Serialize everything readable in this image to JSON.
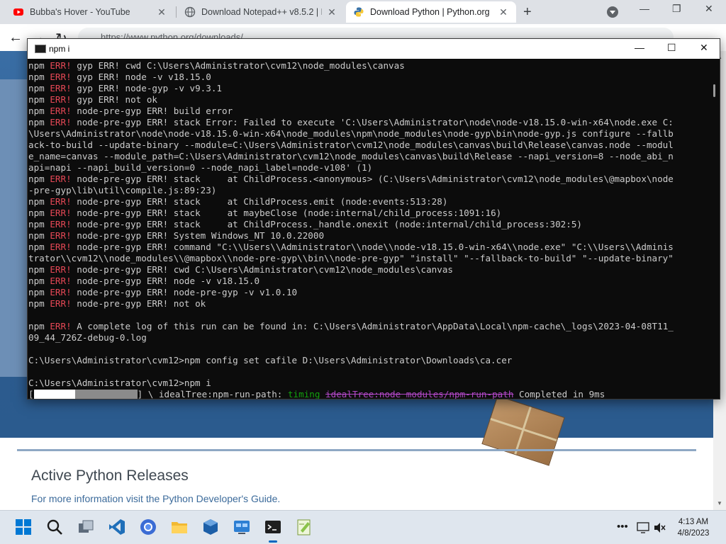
{
  "browser": {
    "tabs": [
      {
        "title": "Bubba's Hover - YouTube",
        "favicon": "youtube-icon"
      },
      {
        "title": "Download Notepad++ v8.5.2 | N",
        "favicon": "globe-icon"
      },
      {
        "title": "Download Python | Python.org",
        "favicon": "python-icon"
      }
    ],
    "new_tab": "+",
    "url": "https://www.python.org/downloads/",
    "back": "←",
    "forward": "→",
    "reload": "↻"
  },
  "page": {
    "releases_title": "Active Python Releases",
    "releases_link": "For more information visit the Python Developer's Guide."
  },
  "terminal": {
    "title": "npm i",
    "minimize": "—",
    "maximize": "☐",
    "close": "✕",
    "lines": [
      [
        {
          "t": "npm "
        },
        {
          "t": "ERR!",
          "c": "err"
        },
        {
          "t": " gyp ERR! cwd C:\\Users\\Administrator\\cvm12\\node_modules\\canvas"
        }
      ],
      [
        {
          "t": "npm "
        },
        {
          "t": "ERR!",
          "c": "err"
        },
        {
          "t": " gyp ERR! node -v v18.15.0"
        }
      ],
      [
        {
          "t": "npm "
        },
        {
          "t": "ERR!",
          "c": "err"
        },
        {
          "t": " gyp ERR! node-gyp -v v9.3.1"
        }
      ],
      [
        {
          "t": "npm "
        },
        {
          "t": "ERR!",
          "c": "err"
        },
        {
          "t": " gyp ERR! not ok"
        }
      ],
      [
        {
          "t": "npm "
        },
        {
          "t": "ERR!",
          "c": "err"
        },
        {
          "t": " node-pre-gyp ERR! build error"
        }
      ],
      [
        {
          "t": "npm "
        },
        {
          "t": "ERR!",
          "c": "err"
        },
        {
          "t": " node-pre-gyp ERR! stack Error: Failed to execute 'C:\\Users\\Administrator\\node\\node-v18.15.0-win-x64\\node.exe C:"
        }
      ],
      [
        {
          "t": "\\Users\\Administrator\\node\\node-v18.15.0-win-x64\\node_modules\\npm\\node_modules\\node-gyp\\bin\\node-gyp.js configure --fallb"
        }
      ],
      [
        {
          "t": "ack-to-build --update-binary --module=C:\\Users\\Administrator\\cvm12\\node_modules\\canvas\\build\\Release\\canvas.node --modul"
        }
      ],
      [
        {
          "t": "e_name=canvas --module_path=C:\\Users\\Administrator\\cvm12\\node_modules\\canvas\\build\\Release --napi_version=8 --node_abi_n"
        }
      ],
      [
        {
          "t": "api=napi --napi_build_version=0 --node_napi_label=node-v108' (1)"
        }
      ],
      [
        {
          "t": "npm "
        },
        {
          "t": "ERR!",
          "c": "err"
        },
        {
          "t": " node-pre-gyp ERR! stack     at ChildProcess.<anonymous> (C:\\Users\\Administrator\\cvm12\\node_modules\\@mapbox\\node"
        }
      ],
      [
        {
          "t": "-pre-gyp\\lib\\util\\compile.js:89:23)"
        }
      ],
      [
        {
          "t": "npm "
        },
        {
          "t": "ERR!",
          "c": "err"
        },
        {
          "t": " node-pre-gyp ERR! stack     at ChildProcess.emit (node:events:513:28)"
        }
      ],
      [
        {
          "t": "npm "
        },
        {
          "t": "ERR!",
          "c": "err"
        },
        {
          "t": " node-pre-gyp ERR! stack     at maybeClose (node:internal/child_process:1091:16)"
        }
      ],
      [
        {
          "t": "npm "
        },
        {
          "t": "ERR!",
          "c": "err"
        },
        {
          "t": " node-pre-gyp ERR! stack     at ChildProcess._handle.onexit (node:internal/child_process:302:5)"
        }
      ],
      [
        {
          "t": "npm "
        },
        {
          "t": "ERR!",
          "c": "err"
        },
        {
          "t": " node-pre-gyp ERR! System Windows_NT 10.0.22000"
        }
      ],
      [
        {
          "t": "npm "
        },
        {
          "t": "ERR!",
          "c": "err"
        },
        {
          "t": " node-pre-gyp ERR! command \"C:\\\\Users\\\\Administrator\\\\node\\\\node-v18.15.0-win-x64\\\\node.exe\" \"C:\\\\Users\\\\Adminis"
        }
      ],
      [
        {
          "t": "trator\\\\cvm12\\\\node_modules\\\\@mapbox\\\\node-pre-gyp\\\\bin\\\\node-pre-gyp\" \"install\" \"--fallback-to-build\" \"--update-binary\""
        }
      ],
      [
        {
          "t": "npm "
        },
        {
          "t": "ERR!",
          "c": "err"
        },
        {
          "t": " node-pre-gyp ERR! cwd C:\\Users\\Administrator\\cvm12\\node_modules\\canvas"
        }
      ],
      [
        {
          "t": "npm "
        },
        {
          "t": "ERR!",
          "c": "err"
        },
        {
          "t": " node-pre-gyp ERR! node -v v18.15.0"
        }
      ],
      [
        {
          "t": "npm "
        },
        {
          "t": "ERR!",
          "c": "err"
        },
        {
          "t": " node-pre-gyp ERR! node-pre-gyp -v v1.0.10"
        }
      ],
      [
        {
          "t": "npm "
        },
        {
          "t": "ERR!",
          "c": "err"
        },
        {
          "t": " node-pre-gyp ERR! not ok"
        }
      ],
      [],
      [
        {
          "t": "npm "
        },
        {
          "t": "ERR!",
          "c": "err"
        },
        {
          "t": " A complete log of this run can be found in: C:\\Users\\Administrator\\AppData\\Local\\npm-cache\\_logs\\2023-04-08T11_"
        }
      ],
      [
        {
          "t": "09_44_726Z-debug-0.log"
        }
      ],
      [],
      [
        {
          "t": "C:\\Users\\Administrator\\cvm12>npm config set cafile D:\\Users\\Administrator\\Downloads\\ca.cer"
        }
      ],
      [],
      [
        {
          "t": "C:\\Users\\Administrator\\cvm12>npm i"
        }
      ]
    ],
    "progress": {
      "open_bracket": "[",
      "close_bracket": "]",
      "spinner": "\\",
      "stage": "idealTree:npm-run-path:",
      "timing_label": "timing",
      "timing_target": "idealTree:node_modules/npm-run-path",
      "completed": "Completed in 9ms"
    }
  },
  "taskbar": {
    "icons": [
      "windows-start-icon",
      "search-icon",
      "task-view-icon",
      "vscode-icon",
      "chrome-icon",
      "file-explorer-icon",
      "virtualbox-icon",
      "control-panel-icon",
      "terminal-icon",
      "notepad-plus-plus-icon"
    ],
    "overflow": "•••",
    "time": "4:13 AM",
    "date": "4/8/2023"
  }
}
